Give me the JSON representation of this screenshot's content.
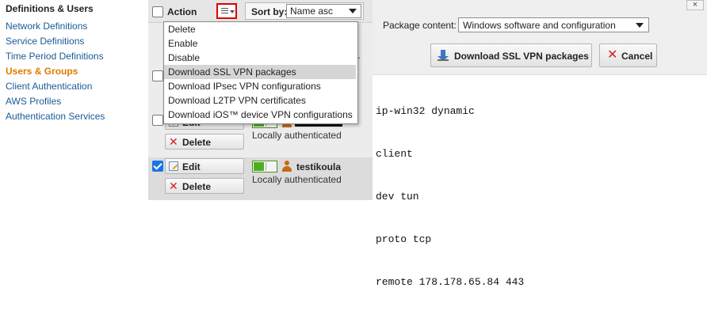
{
  "nav": {
    "title": "Definitions & Users",
    "items": [
      {
        "label": "Network Definitions"
      },
      {
        "label": "Service Definitions"
      },
      {
        "label": "Time Period Definitions"
      },
      {
        "label": "Users & Groups"
      },
      {
        "label": "Client Authentication"
      },
      {
        "label": "AWS Profiles"
      },
      {
        "label": "Authentication Services"
      }
    ]
  },
  "toolbar": {
    "action_label": "Action",
    "sort_label": "Sort by:",
    "sort_value": "Name asc"
  },
  "dropdown": {
    "items": [
      {
        "label": "Delete"
      },
      {
        "label": "Enable"
      },
      {
        "label": "Disable"
      },
      {
        "label": "Download SSL VPN packages"
      },
      {
        "label": "Download IPsec VPN configurations"
      },
      {
        "label": "Download L2TP VPN certificates"
      },
      {
        "label": "Download iOS™ device VPN configurations"
      }
    ]
  },
  "rows": [
    {
      "edit_label": "Edit",
      "delete_label": "Delete",
      "auth": "Locally authenticated"
    },
    {
      "edit_label": "Edit",
      "delete_label": "Delete",
      "username": "testikoula",
      "auth": "Locally authenticated"
    }
  ],
  "partial_char": "r",
  "detail": {
    "package_content_label": "Package content:",
    "package_content_value": "Windows software and configuration",
    "download_label": "Download SSL VPN packages",
    "cancel_label": "Cancel",
    "close_label": "×",
    "config_lines": [
      "ip-win32 dynamic",
      "client",
      "dev tun",
      "proto tcp",
      "remote 178.178.65.84 443"
    ]
  },
  "colors": {
    "link": "#1a5a96",
    "active_nav": "#e07b00",
    "highlight_border": "#e00000",
    "toggle_on": "#4caf23"
  }
}
